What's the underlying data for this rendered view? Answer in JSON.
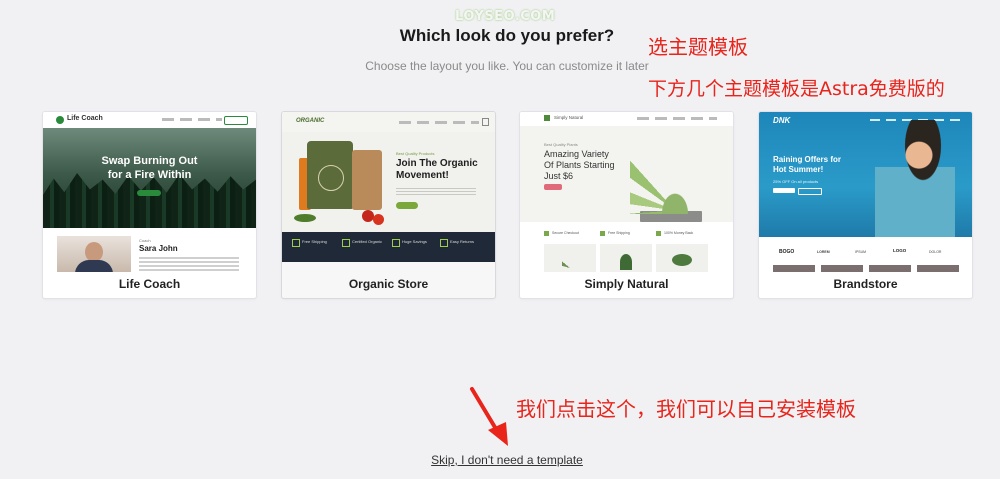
{
  "watermark": "LOYSEO.COM",
  "heading": "Which look do you prefer?",
  "subheading": "Choose the layout you like. You can customize it later",
  "annotations": {
    "choose_template": "选主题模板",
    "free_templates_note": "下方几个主题模板是Astra免费版的",
    "skip_note": "我们点击这个，我们可以自己安装模板"
  },
  "templates": [
    {
      "name": "Life Coach",
      "preview": {
        "logo": "Life Coach",
        "hero_line1": "Swap Burning Out",
        "hero_line2": "for a Fire Within",
        "person_label": "Coach",
        "person_name": "Sara John"
      }
    },
    {
      "name": "Organic Store",
      "preview": {
        "logo": "ORGANIC",
        "kicker": "Best Quality Products",
        "hero_line1": "Join The Organic",
        "hero_line2": "Movement!",
        "features": [
          "Free Shipping",
          "Certified Organic",
          "Huge Savings",
          "Easy Returns"
        ]
      }
    },
    {
      "name": "Simply Natural",
      "preview": {
        "logo": "Simply Natural",
        "kicker": "Best Quality Plants",
        "hero_line1": "Amazing Variety",
        "hero_line2": "Of Plants Starting",
        "hero_line3": "Just $6",
        "features": [
          "Secure Checkout",
          "Free Shipping",
          "100% Money Back"
        ]
      }
    },
    {
      "name": "Brandstore",
      "preview": {
        "logo": "DNK",
        "hero_line1": "Raining Offers for",
        "hero_line2": "Hot Summer!",
        "offer": "25% OFF On all products",
        "brands": [
          "BOGO",
          "LOREM",
          "IPSUM",
          "LOGO",
          "DOLOR"
        ]
      }
    }
  ],
  "skip_link": "Skip, I don't need a template",
  "colors": {
    "page_bg": "#f1f1f4",
    "annotation_red": "#e8241b",
    "life_coach_green": "#2a8a3c",
    "organic_dark": "#1f2937",
    "brandstore_blue": "#1b7fb3"
  }
}
